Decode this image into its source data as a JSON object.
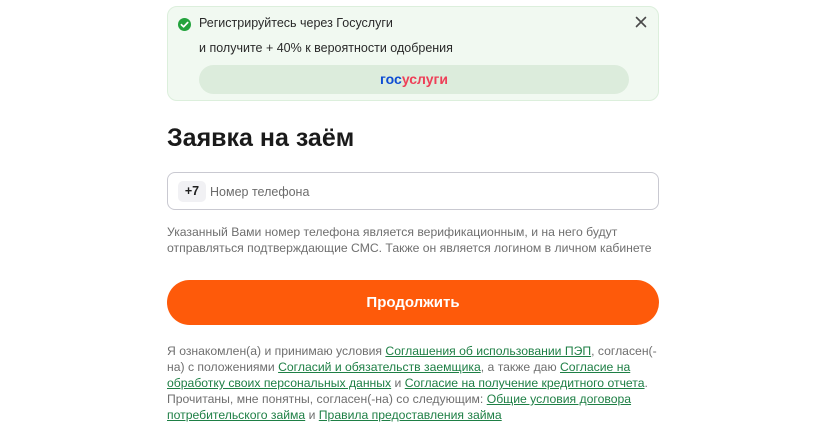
{
  "banner": {
    "title": "Регистрируйтесь через Госуслуги",
    "subtitle": "и получите + 40% к вероятности одобрения",
    "gosuslugi_button": {
      "part1": "гос",
      "part2": "услуги"
    },
    "icons": {
      "status": "check-circle-icon",
      "close": "close-icon"
    },
    "colors": {
      "background": "#f1f9f1",
      "check": "#23a33d",
      "gos_blue": "#0d4cd3",
      "gos_red": "#ee3f58"
    }
  },
  "form": {
    "title": "Заявка на заём",
    "phone": {
      "prefix": "+7",
      "placeholder": "Номер телефона",
      "value": ""
    },
    "hint_lines": [
      "Указанный Вами номер телефона является верификационным, и на него будут",
      "отправляться подтверждающие СМС. Также он является логином в личном кабинете"
    ],
    "continue_label": "Продолжить",
    "colors": {
      "accent": "#fe5a0a",
      "link": "#1e7f45"
    }
  },
  "terms": {
    "l1_text1": "Я ознакомлен(а) и принимаю условия ",
    "l1_link1": "Соглашения об использовании ПЭП",
    "l1_text2": ", согласен(-",
    "l2_text1": "на) с положениями ",
    "l2_link1": "Согласий и обязательств заемщика",
    "l2_text2": ", а также даю ",
    "l2_link2": "Согласие на",
    "l3_link1": "обработку своих персональных данных",
    "l3_text1": " и ",
    "l3_link2": "Согласие на получение кредитного отчета",
    "l3_text2": ".",
    "l4_text1": "Прочитаны, мне понятны, согласен(-на) со следующим: ",
    "l4_link1": "Общие условия договора",
    "l5_link1": "потребительского займа",
    "l5_text1": " и ",
    "l5_link2": "Правила предоставления займа"
  }
}
